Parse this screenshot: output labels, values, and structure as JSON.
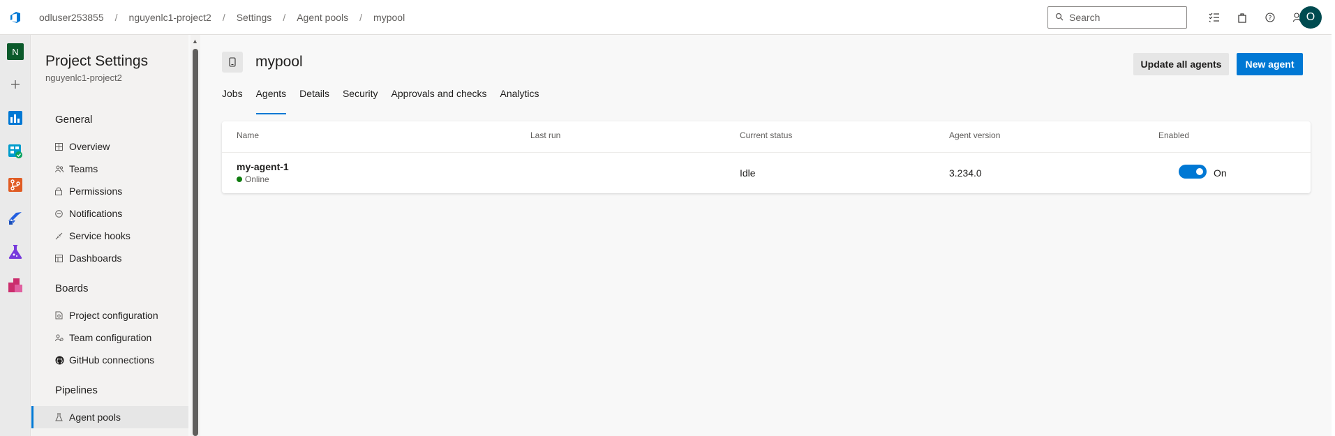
{
  "breadcrumb": {
    "items": [
      "odluser253855",
      "nguyenlc1-project2",
      "Settings",
      "Agent pools",
      "mypool"
    ],
    "separator": "/"
  },
  "search": {
    "placeholder": "Search"
  },
  "user": {
    "initial": "O"
  },
  "rail": {
    "org_initial": "N"
  },
  "settings_nav": {
    "title": "Project Settings",
    "project": "nguyenlc1-project2",
    "sections": {
      "general": "General",
      "boards": "Boards",
      "pipelines": "Pipelines"
    },
    "general_items": [
      "Overview",
      "Teams",
      "Permissions",
      "Notifications",
      "Service hooks",
      "Dashboards"
    ],
    "boards_items": [
      "Project configuration",
      "Team configuration",
      "GitHub connections"
    ],
    "pipelines_items": [
      "Agent pools"
    ]
  },
  "pool": {
    "name": "mypool",
    "update_button": "Update all agents",
    "new_button": "New agent",
    "tabs": [
      "Jobs",
      "Agents",
      "Details",
      "Security",
      "Approvals and checks",
      "Analytics"
    ],
    "active_tab": "Agents"
  },
  "table": {
    "headers": [
      "Name",
      "Last run",
      "Current status",
      "Agent version",
      "Enabled"
    ],
    "rows": [
      {
        "name": "my-agent-1",
        "online": "Online",
        "last_run": "",
        "status": "Idle",
        "version": "3.234.0",
        "enabled": "On"
      }
    ]
  },
  "colors": {
    "accent": "#0078d4",
    "online": "#107c10",
    "avatar": "#004b50",
    "org_badge": "#0b5a2b"
  }
}
